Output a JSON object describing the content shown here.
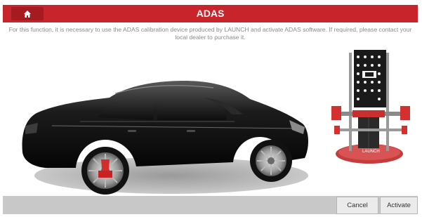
{
  "header": {
    "title": "ADAS",
    "home_icon": "home-icon",
    "accent_color": "#c8242c"
  },
  "notice": {
    "text": "For this function, it is necessary to use the ADAS calibration device produced by LAUNCH and activate ADAS software. If required, please contact your local dealer to purchase it."
  },
  "illustration": {
    "car": "black-sedan-illustration",
    "device": "adas-calibration-frame-illustration",
    "device_brand": "LAUNCH"
  },
  "footer": {
    "cancel_label": "Cancel",
    "activate_label": "Activate"
  }
}
